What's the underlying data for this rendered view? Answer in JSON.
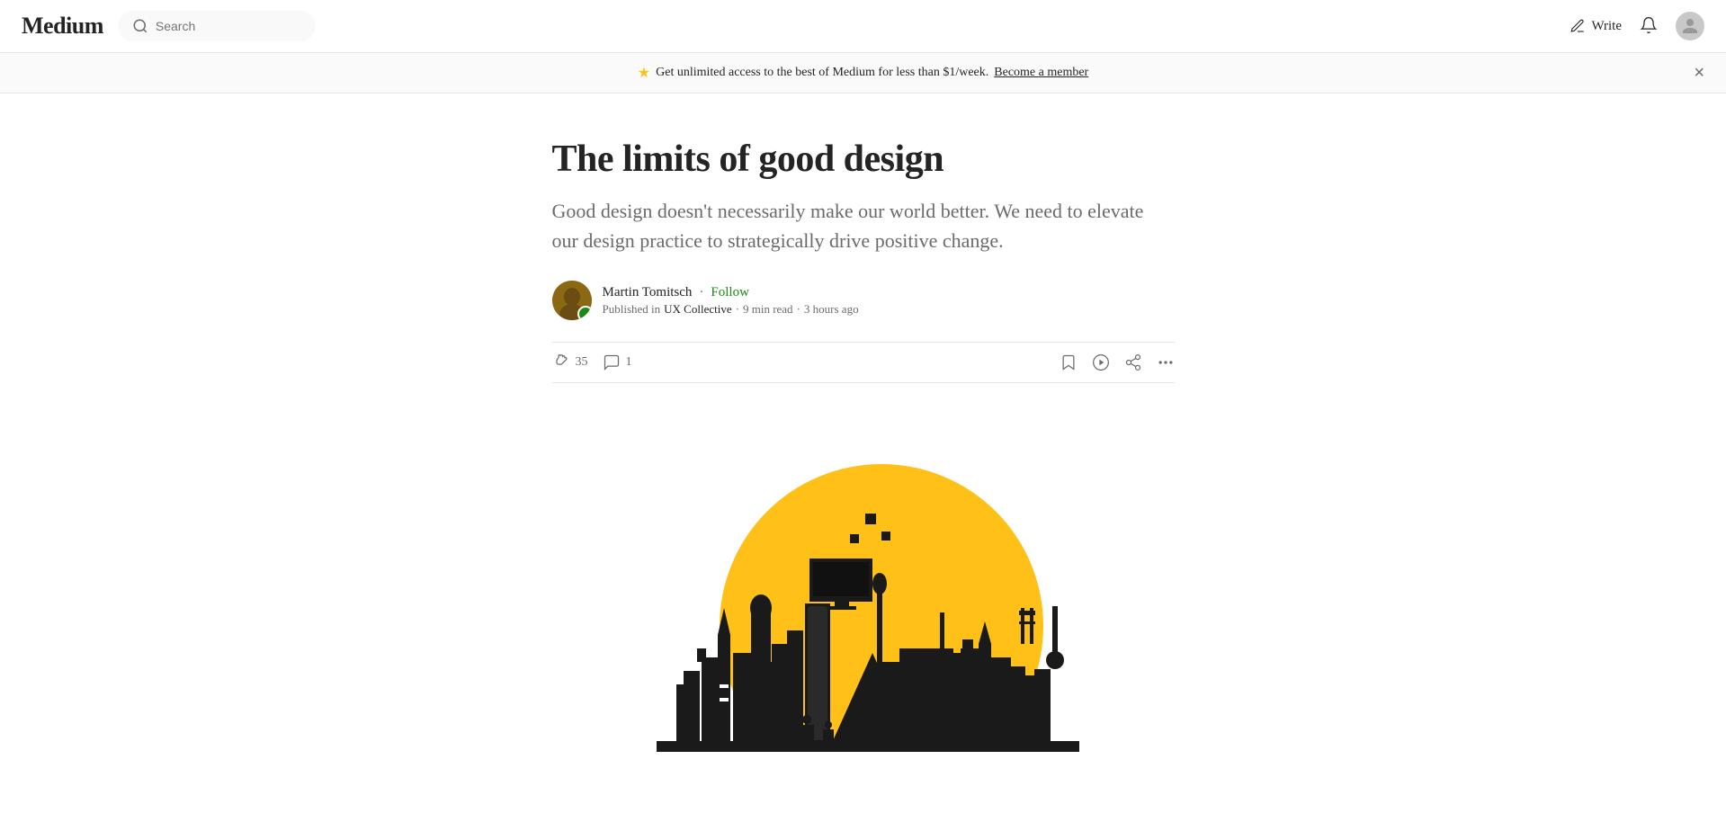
{
  "header": {
    "logo": "Medium",
    "search_placeholder": "Search",
    "write_label": "Write",
    "actions": {
      "write": "Write",
      "notifications": "Notifications",
      "profile": "Profile"
    }
  },
  "banner": {
    "star_icon": "★",
    "text": "Get unlimited access to the best of Medium for less than $1/week.",
    "cta_label": "Become a member",
    "close_label": "×"
  },
  "article": {
    "title": "The limits of good design",
    "subtitle": "Good design doesn't necessarily make our world better. We need to elevate our design practice to strategically drive positive change.",
    "author": {
      "name": "Martin Tomitsch",
      "follow_label": "Follow",
      "publication": "UX Collective",
      "read_time": "9 min read",
      "time_ago": "3 hours ago"
    },
    "meta": {
      "published_in": "Published in",
      "dot": "·"
    },
    "actions": {
      "clap_count": "35",
      "comment_count": "1",
      "bookmark_label": "Save",
      "listen_label": "Listen",
      "share_label": "Share",
      "more_label": "More"
    }
  }
}
